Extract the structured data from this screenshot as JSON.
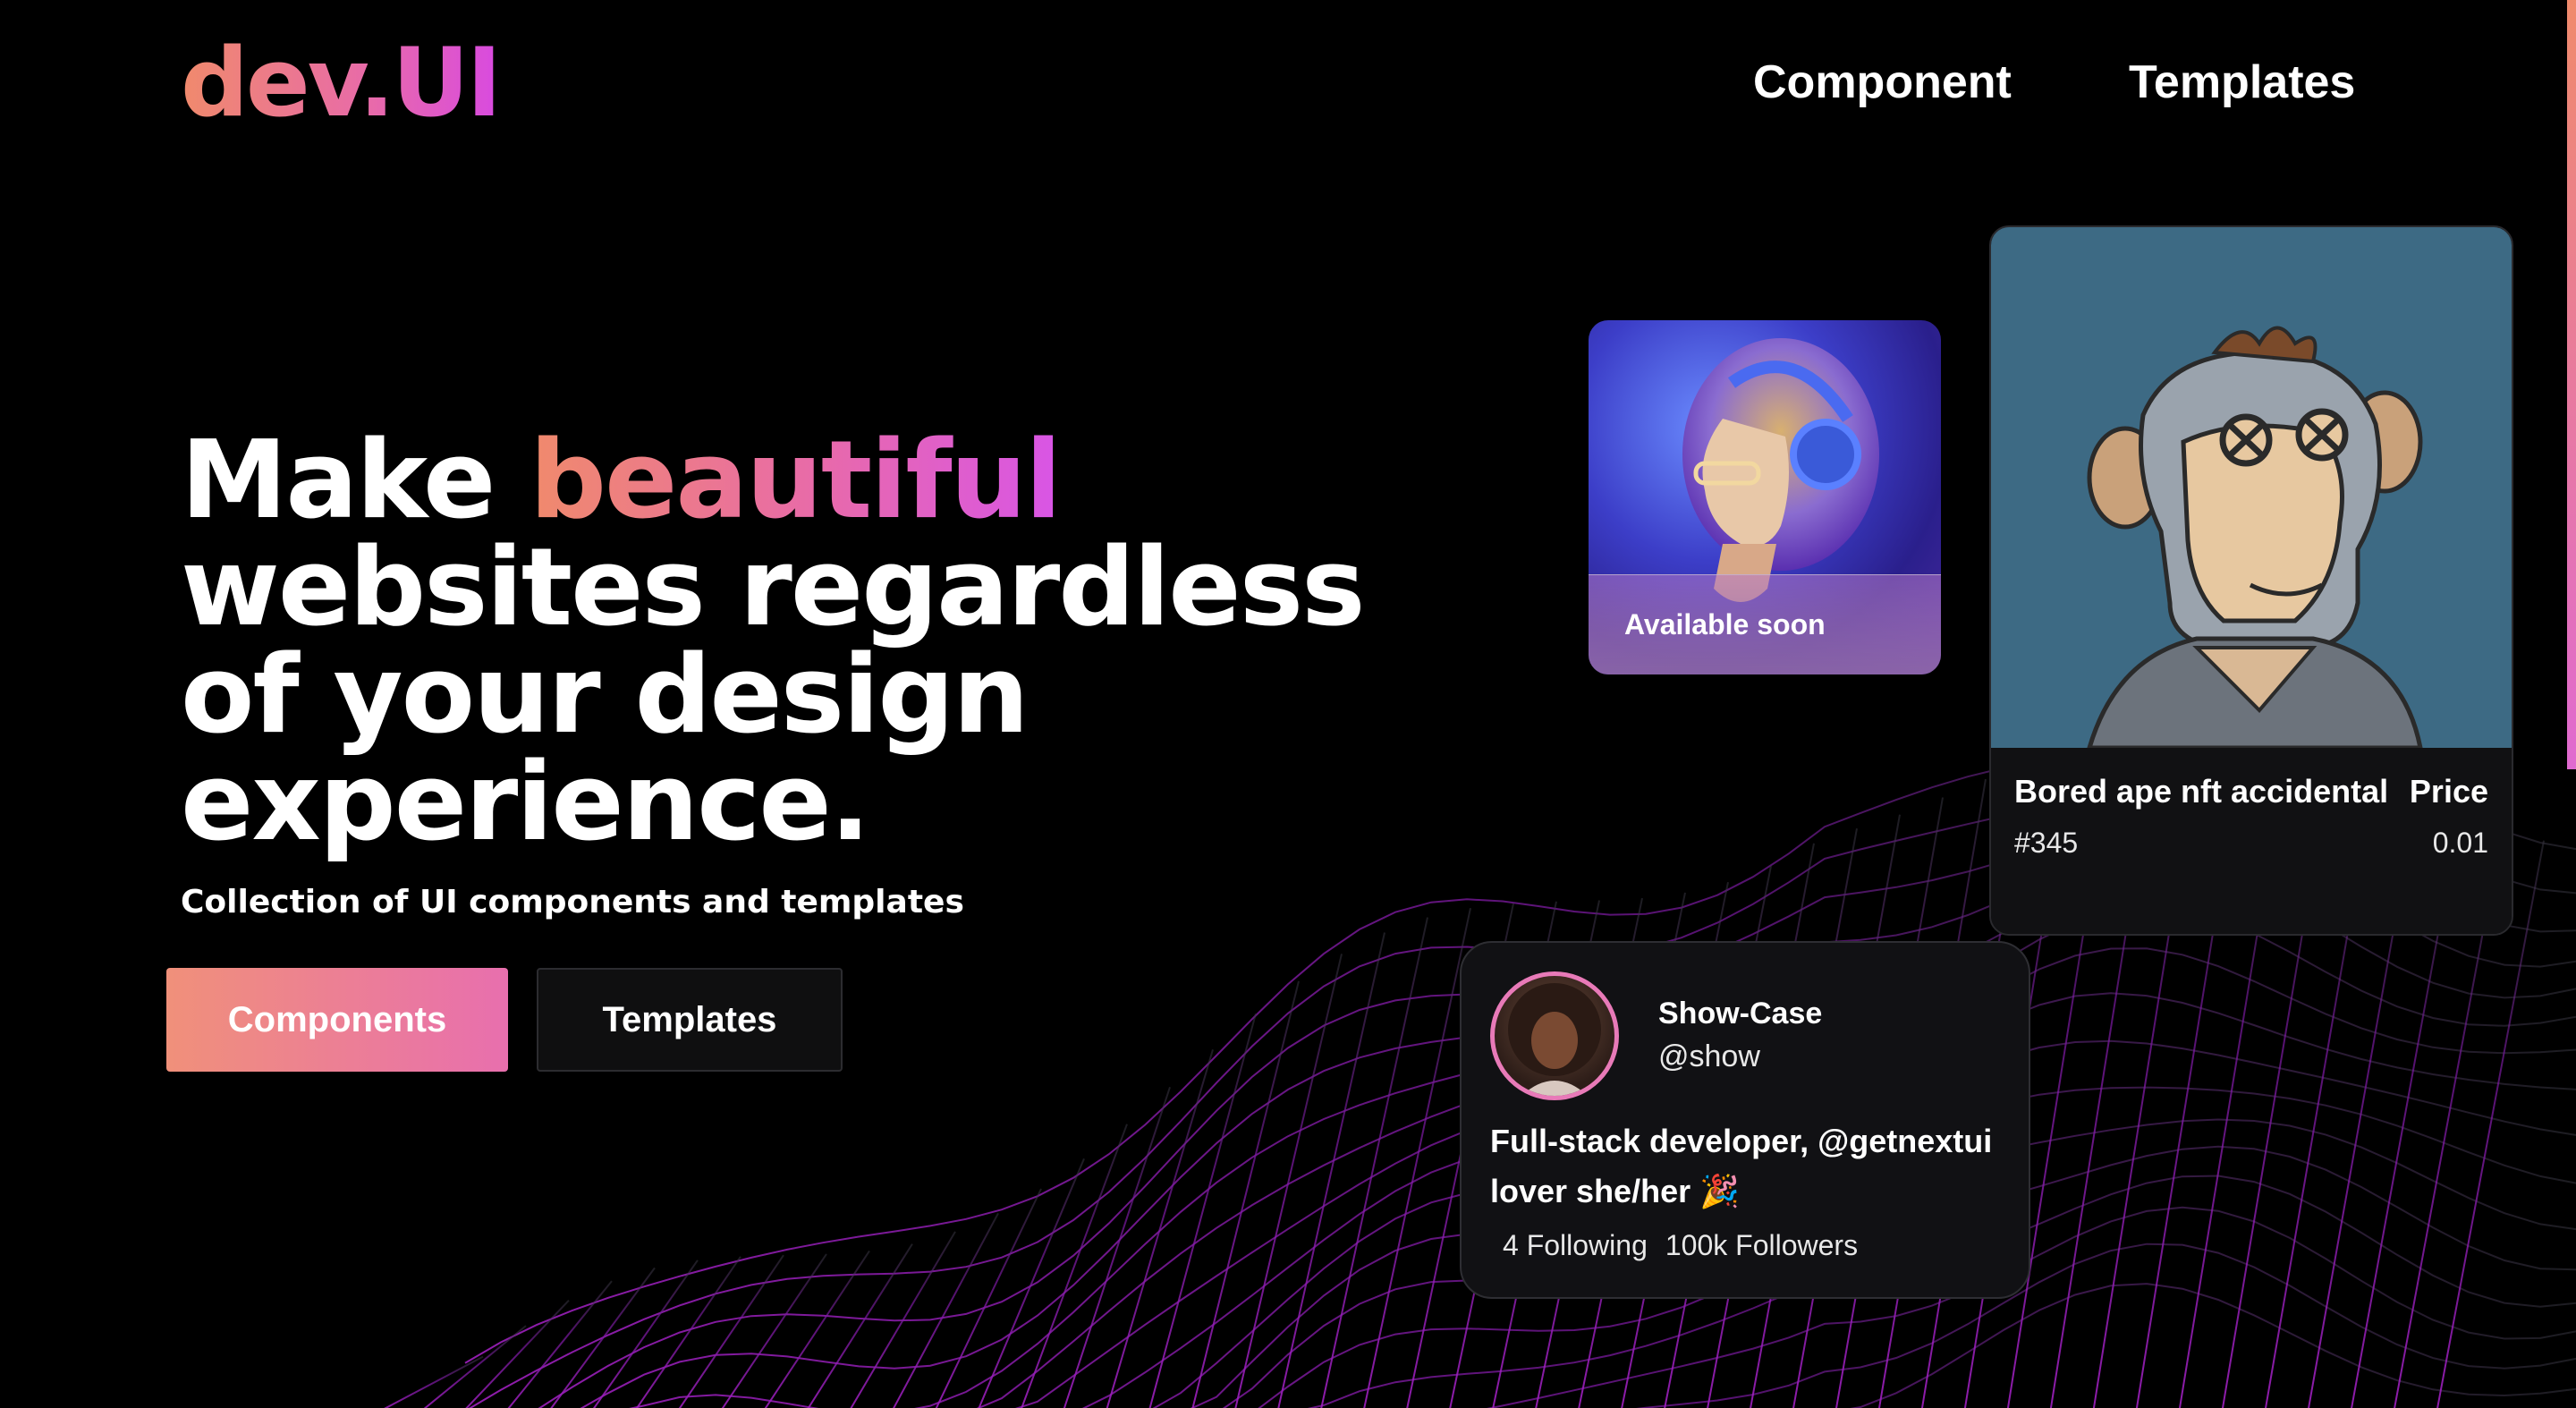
{
  "brand": {
    "logo_text": "dev.UI"
  },
  "nav": {
    "component_label": "Component",
    "templates_label": "Templates"
  },
  "hero": {
    "headline_pre": "Make ",
    "headline_accent": "beautiful",
    "headline_line2": "websites regardless",
    "headline_line3": "of your design",
    "headline_line4": "experience.",
    "subtitle": "Collection of UI components and templates"
  },
  "buttons": {
    "components_label": "Components",
    "templates_label": "Templates"
  },
  "music_card": {
    "caption": "Available soon"
  },
  "nft_card": {
    "title": "Bored ape nft accidental",
    "price_label": "Price",
    "id": "#345",
    "price_value": "0.01"
  },
  "profile_card": {
    "name": "Show-Case",
    "handle": "@show",
    "bio": "Full-stack developer, @getnextui lover she/her 🎉",
    "following": "4 Following",
    "followers": "100k Followers"
  },
  "colors": {
    "accent_start": "#f08a6c",
    "accent_mid": "#e86aaa",
    "accent_end": "#d84ae0",
    "background": "#000000"
  }
}
